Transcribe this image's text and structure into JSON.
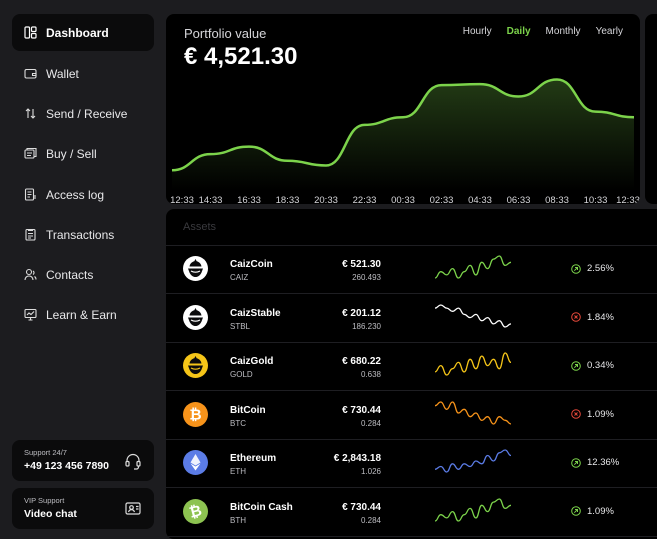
{
  "sidebar": {
    "items": [
      {
        "label": "Dashboard",
        "icon": "dashboard-icon",
        "active": true
      },
      {
        "label": "Wallet",
        "icon": "wallet-icon"
      },
      {
        "label": "Send / Receive",
        "icon": "send-receive-icon"
      },
      {
        "label": "Buy / Sell",
        "icon": "buy-sell-icon"
      },
      {
        "label": "Access log",
        "icon": "access-log-icon"
      },
      {
        "label": "Transactions",
        "icon": "transactions-icon"
      },
      {
        "label": "Contacts",
        "icon": "contacts-icon"
      },
      {
        "label": "Learn & Earn",
        "icon": "learn-earn-icon"
      }
    ],
    "support": {
      "caption": "Support 24/7",
      "phone": "+49 123 456 7890",
      "icon": "headset-icon"
    },
    "vip": {
      "caption": "VIP Support",
      "label": "Video chat",
      "icon": "video-chat-icon"
    }
  },
  "portfolio": {
    "title": "Portfolio value",
    "value": "€ 4,521.30",
    "tabs": [
      {
        "label": "Hourly"
      },
      {
        "label": "Daily",
        "active": true
      },
      {
        "label": "Monthly"
      },
      {
        "label": "Yearly"
      }
    ]
  },
  "chart_data": {
    "type": "area",
    "x": [
      "12:33",
      "14:33",
      "16:33",
      "18:33",
      "20:33",
      "22:33",
      "00:33",
      "02:33",
      "04:33",
      "06:33",
      "08:33",
      "10:33",
      "12:33"
    ],
    "values": [
      4,
      21,
      29,
      14,
      9,
      52,
      60,
      94,
      95,
      82,
      100,
      66,
      60
    ],
    "ylim": [
      0,
      110
    ],
    "line_color": "#7cd34b",
    "grid": false,
    "legend": "none"
  },
  "assets": {
    "header": "Assets",
    "rows": [
      {
        "name": "CaizCoin",
        "symbol": "CAIZ",
        "value": "€ 521.30",
        "amount": "260.493",
        "change": "2.56%",
        "trend": "up",
        "icon": "caizcoin-icon",
        "icon_bg": "#ffffff",
        "icon_fg": "#0b0b0c",
        "spark_color": "#7cd34b",
        "spark": [
          3,
          5,
          4,
          6,
          3,
          5,
          7,
          4,
          8,
          6,
          9,
          10,
          7,
          8
        ]
      },
      {
        "name": "CaizStable",
        "symbol": "STBL",
        "value": "€ 201.12",
        "amount": "186.230",
        "change": "1.84%",
        "trend": "down",
        "icon": "caizstable-icon",
        "icon_bg": "#ffffff",
        "icon_fg": "#0b0b0c",
        "spark_color": "#ffffff",
        "spark": [
          8,
          9,
          8,
          7,
          8,
          6,
          5,
          6,
          4,
          5,
          3,
          4,
          2,
          3
        ]
      },
      {
        "name": "CaizGold",
        "symbol": "GOLD",
        "value": "€ 680.22",
        "amount": "0.638",
        "change": "0.34%",
        "trend": "up",
        "icon": "caizgold-icon",
        "icon_bg": "#f5c518",
        "icon_fg": "#0b0b0c",
        "spark_color": "#f5c518",
        "spark": [
          3,
          5,
          2,
          4,
          6,
          3,
          7,
          4,
          8,
          5,
          7,
          4,
          9,
          6
        ]
      },
      {
        "name": "BitCoin",
        "symbol": "BTC",
        "value": "€ 730.44",
        "amount": "0.284",
        "change": "1.09%",
        "trend": "down",
        "icon": "bitcoin-icon",
        "icon_bg": "#f7931a",
        "icon_fg": "#ffffff",
        "spark_color": "#f7931a",
        "spark": [
          8,
          9,
          7,
          9,
          6,
          7,
          5,
          6,
          4,
          5,
          3,
          5,
          4,
          3
        ]
      },
      {
        "name": "Ethereum",
        "symbol": "ETH",
        "value": "€ 2,843.18",
        "amount": "1.026",
        "change": "12.36%",
        "trend": "up",
        "icon": "ethereum-icon",
        "icon_bg": "#5b7ce6",
        "icon_fg": "#ffffff",
        "spark_color": "#5b7ce6",
        "spark": [
          3,
          4,
          2,
          5,
          3,
          5,
          4,
          6,
          5,
          8,
          6,
          9,
          10,
          8
        ]
      },
      {
        "name": "BitCoin Cash",
        "symbol": "BTH",
        "value": "€ 730.44",
        "amount": "0.284",
        "change": "1.09%",
        "trend": "up",
        "icon": "bitcoin-cash-icon",
        "icon_bg": "#8dc351",
        "icon_fg": "#ffffff",
        "spark_color": "#7cd34b",
        "spark": [
          3,
          5,
          4,
          6,
          3,
          5,
          7,
          4,
          8,
          6,
          9,
          10,
          7,
          8
        ]
      }
    ]
  },
  "colors": {
    "accent": "#7cd34b",
    "up": "#7cd34b",
    "down": "#e5483a",
    "card": "#000000",
    "background": "#1c1c1f"
  }
}
